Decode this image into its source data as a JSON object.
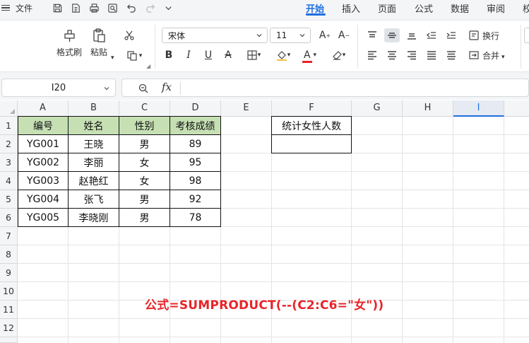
{
  "menu": {
    "file_label": "文件",
    "tabs": [
      "开始",
      "插入",
      "页面",
      "公式",
      "数据",
      "审阅",
      "校"
    ],
    "active_tab": "开始"
  },
  "ribbon": {
    "format_painter": "格式刷",
    "paste": "粘贴",
    "font_name": "宋体",
    "font_size": "11",
    "wrap_text": "换行",
    "merge": "合并"
  },
  "formula_bar": {
    "cell_ref": "I20",
    "fx_label": "fx",
    "formula": ""
  },
  "sheet": {
    "columns": [
      "A",
      "B",
      "C",
      "D",
      "E",
      "F",
      "G",
      "H",
      "I"
    ],
    "selected_column": "I",
    "rows": [
      "1",
      "2",
      "3",
      "4",
      "5",
      "6",
      "7",
      "8",
      "9",
      "10",
      "11",
      "12"
    ],
    "table_headers": [
      "编号",
      "姓名",
      "性别",
      "考核成绩"
    ],
    "table_rows": [
      [
        "YG001",
        "王晓",
        "男",
        "89"
      ],
      [
        "YG002",
        "李丽",
        "女",
        "95"
      ],
      [
        "YG003",
        "赵艳红",
        "女",
        "98"
      ],
      [
        "YG004",
        "张飞",
        "男",
        "92"
      ],
      [
        "YG005",
        "李晓刚",
        "男",
        "78"
      ]
    ],
    "stat_header": "统计女性人数",
    "stat_value": "",
    "formula_note": "公式=SUMPRODUCT(--(C2:C6=\"女\"))"
  },
  "colors": {
    "accent": "#1f6fe0",
    "header_fill": "#c6e0b4",
    "note_red": "#e8242a"
  },
  "icons": [
    "menu-icon",
    "save-icon",
    "print-preview-icon",
    "print-icon",
    "find-replace-icon",
    "undo-icon",
    "redo-icon",
    "more-icon",
    "format-painter-icon",
    "paste-icon",
    "cut-icon",
    "copy-icon",
    "bold-icon",
    "italic-icon",
    "underline-icon",
    "strikethrough-icon",
    "border-icon",
    "fill-color-icon",
    "font-color-icon",
    "clear-icon",
    "increase-font-icon",
    "decrease-font-icon",
    "align-top-icon",
    "align-middle-icon",
    "align-bottom-icon",
    "indent-decrease-icon",
    "indent-increase-icon",
    "align-left-icon",
    "align-center-icon",
    "align-right-icon",
    "justify-icon",
    "zoom-icon"
  ]
}
